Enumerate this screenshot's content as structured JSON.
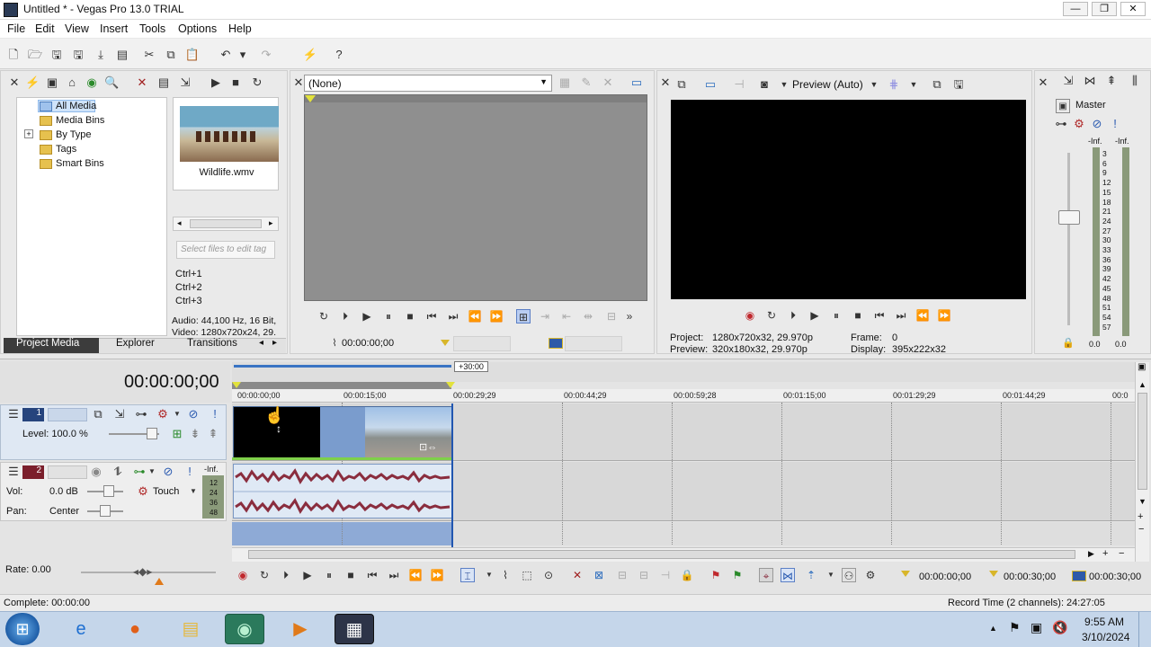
{
  "window": {
    "title": "Untitled * - Vegas Pro 13.0 TRIAL",
    "min": "—",
    "max": "❐",
    "close": "✕"
  },
  "menu": [
    "File",
    "Edit",
    "View",
    "Insert",
    "Tools",
    "Options",
    "Help"
  ],
  "media": {
    "tree": [
      "All Media",
      "Media Bins",
      "By Type",
      "Tags",
      "Smart Bins"
    ],
    "expander": "+",
    "file_name": "Wildlife.wmv",
    "tag_placeholder": "Select files to edit tag",
    "shortcuts": [
      "Ctrl+1",
      "Ctrl+2",
      "Ctrl+3"
    ],
    "info_audio": "Audio: 44,100 Hz, 16 Bit,",
    "info_video": "Video: 1280x720x24, 29.",
    "tabs": [
      "Project Media",
      "Explorer",
      "Transitions"
    ]
  },
  "trimmer": {
    "preset": "(None)",
    "timecode": "00:00:00;00"
  },
  "preview": {
    "mode": "Preview (Auto)",
    "project_label": "Project:",
    "project_value": "1280x720x32, 29.970p",
    "preview_label": "Preview:",
    "preview_value": "320x180x32, 29.970p",
    "frame_label": "Frame:",
    "frame_value": "0",
    "display_label": "Display:",
    "display_value": "395x222x32"
  },
  "master": {
    "label": "Master",
    "inf_left": "-Inf.",
    "inf_right": "-Inf.",
    "scale": [
      "3",
      "6",
      "9",
      "12",
      "15",
      "18",
      "21",
      "24",
      "27",
      "30",
      "33",
      "36",
      "39",
      "42",
      "45",
      "48",
      "51",
      "54",
      "57"
    ],
    "bottom_left": "0.0",
    "bottom_right": "0.0"
  },
  "timeline": {
    "current_time": "00:00:00;00",
    "offset": "+30:00",
    "ruler": [
      "00:00:00;00",
      "00:00:15;00",
      "00:00:29;29",
      "00:00:44;29",
      "00:00:59;28",
      "00:01:15;00",
      "00:01:29;29",
      "00:01:44;29",
      "00:0"
    ],
    "track1": {
      "num": "1",
      "level_label": "Level: 100.0 %"
    },
    "track2": {
      "num": "2",
      "vol_label": "Vol:",
      "vol_value": "0.0 dB",
      "mode": "Touch",
      "pan_label": "Pan:",
      "pan_value": "Center",
      "inf": "-Inf.",
      "meter": [
        "12",
        "24",
        "36",
        "48"
      ]
    },
    "rate": "Rate: 0.00",
    "tc_a": "00:00:00;00",
    "tc_b": "00:00:30;00",
    "tc_c": "00:00:30;00"
  },
  "status": {
    "complete": "Complete: 00:00:00",
    "record": "Record Time (2 channels): 24:27:05"
  },
  "taskbar": {
    "time": "9:55 AM",
    "date": "3/10/2024"
  }
}
